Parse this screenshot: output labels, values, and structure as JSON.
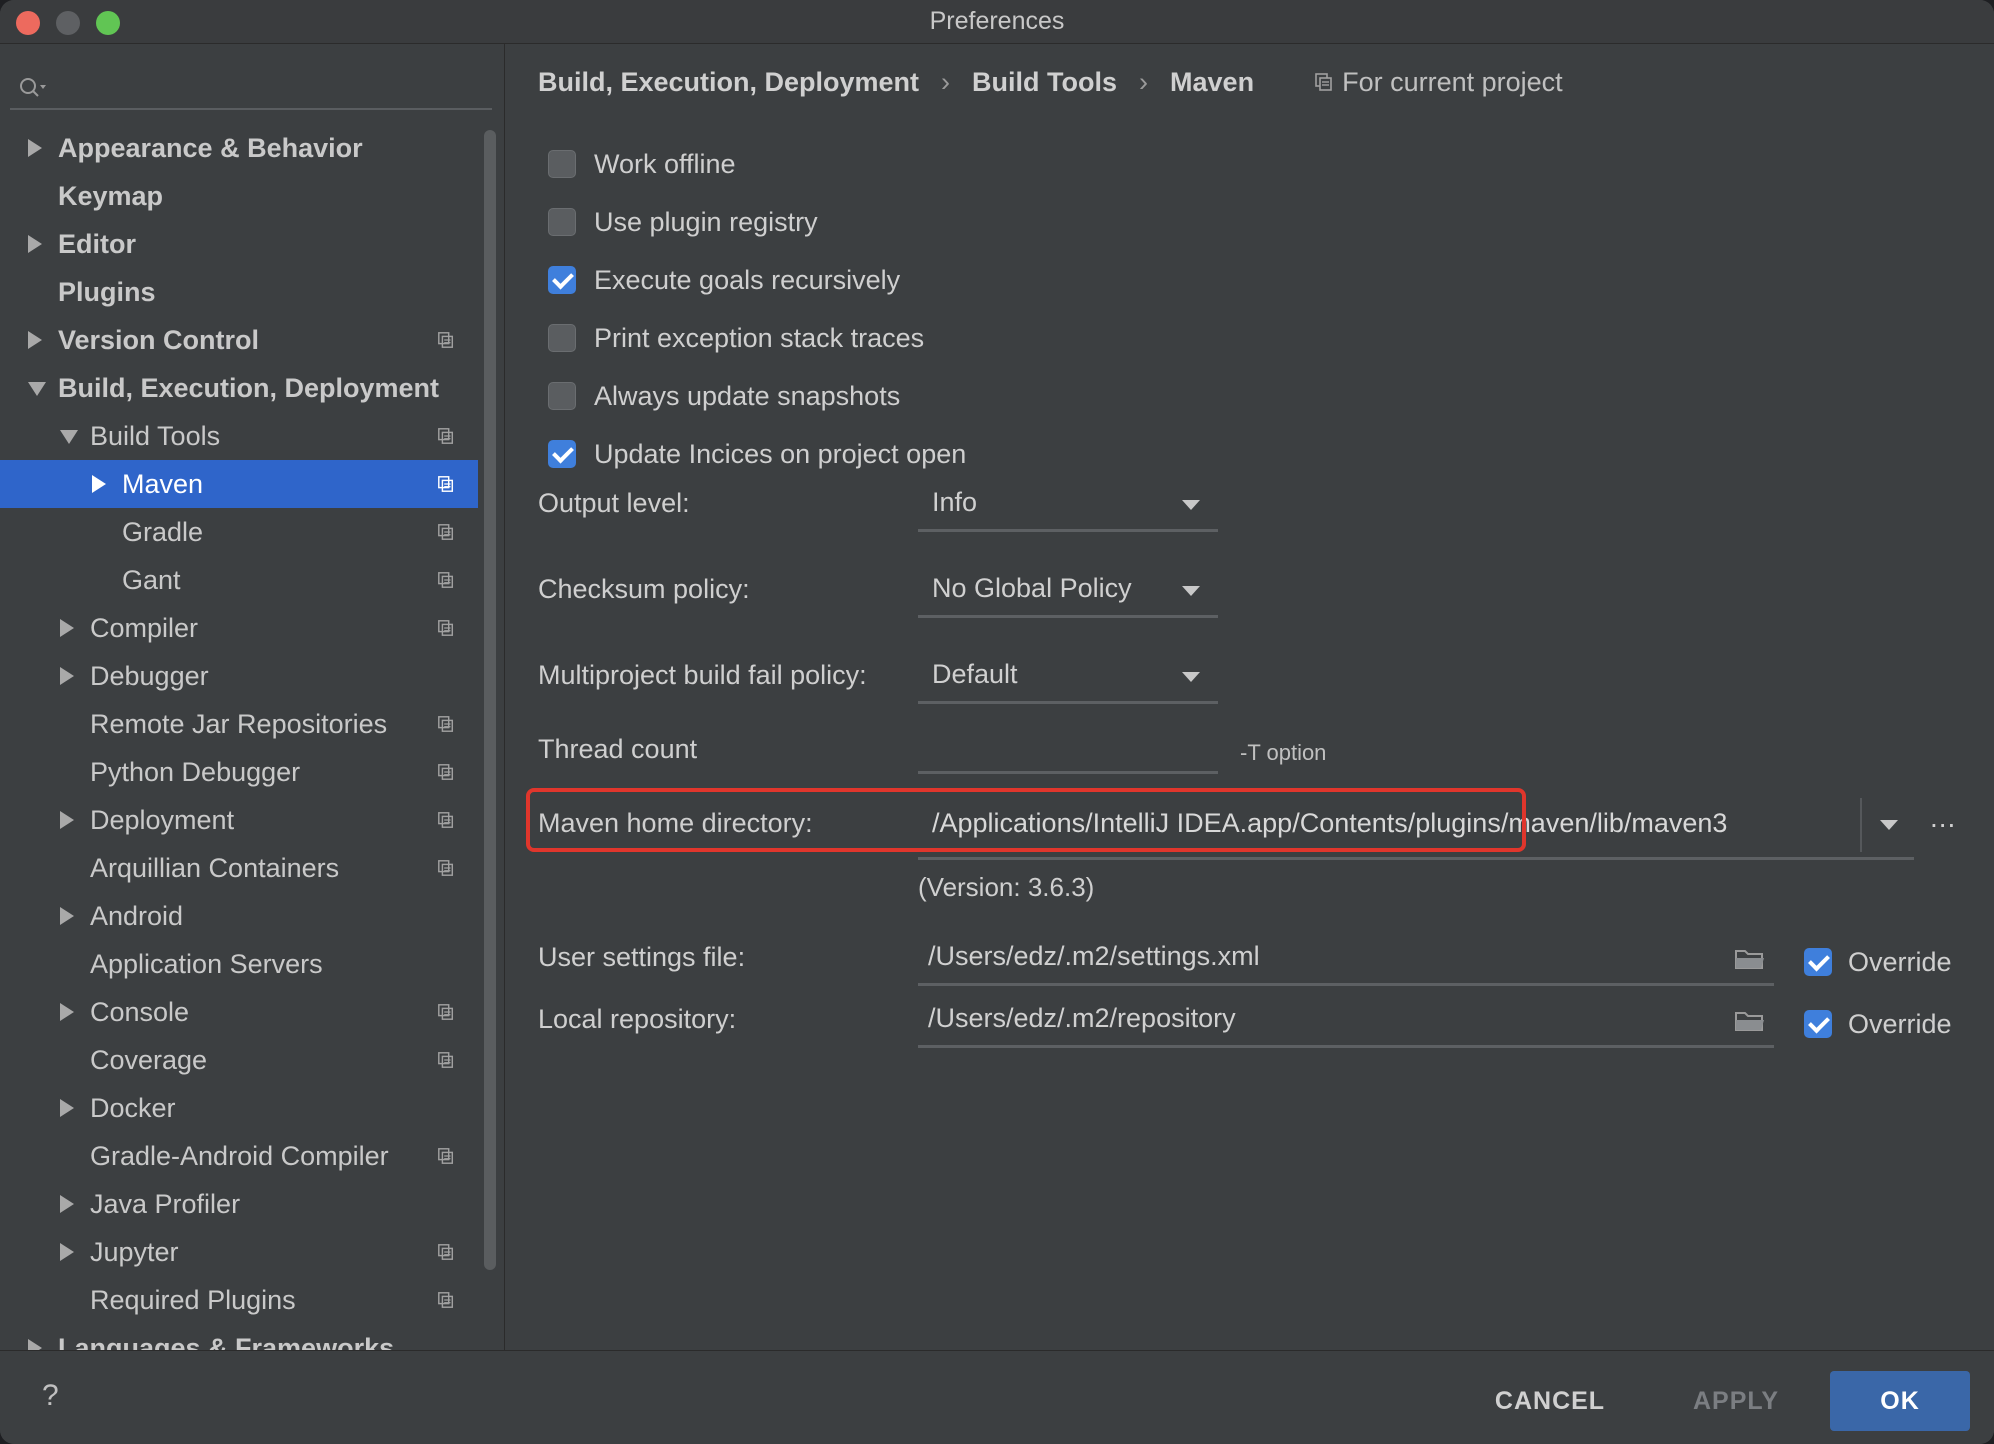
{
  "window": {
    "title": "Preferences"
  },
  "search": {
    "placeholder": ""
  },
  "sidebar": {
    "items": [
      {
        "label": "Appearance & Behavior",
        "indent": 0,
        "arrow": "right",
        "bold": true,
        "proj": false,
        "selected": false
      },
      {
        "label": "Keymap",
        "indent": 0,
        "arrow": "none",
        "bold": true,
        "proj": false,
        "selected": false
      },
      {
        "label": "Editor",
        "indent": 0,
        "arrow": "right",
        "bold": true,
        "proj": false,
        "selected": false
      },
      {
        "label": "Plugins",
        "indent": 0,
        "arrow": "none",
        "bold": true,
        "proj": false,
        "selected": false
      },
      {
        "label": "Version Control",
        "indent": 0,
        "arrow": "right",
        "bold": true,
        "proj": true,
        "selected": false
      },
      {
        "label": "Build, Execution, Deployment",
        "indent": 0,
        "arrow": "down",
        "bold": true,
        "proj": false,
        "selected": false
      },
      {
        "label": "Build Tools",
        "indent": 1,
        "arrow": "down",
        "bold": false,
        "proj": true,
        "selected": false
      },
      {
        "label": "Maven",
        "indent": 2,
        "arrow": "right",
        "bold": false,
        "proj": true,
        "selected": true
      },
      {
        "label": "Gradle",
        "indent": 2,
        "arrow": "none",
        "bold": false,
        "proj": true,
        "selected": false
      },
      {
        "label": "Gant",
        "indent": 2,
        "arrow": "none",
        "bold": false,
        "proj": true,
        "selected": false
      },
      {
        "label": "Compiler",
        "indent": 1,
        "arrow": "right",
        "bold": false,
        "proj": true,
        "selected": false
      },
      {
        "label": "Debugger",
        "indent": 1,
        "arrow": "right",
        "bold": false,
        "proj": false,
        "selected": false
      },
      {
        "label": "Remote Jar Repositories",
        "indent": 1,
        "arrow": "none",
        "bold": false,
        "proj": true,
        "selected": false
      },
      {
        "label": "Python Debugger",
        "indent": 1,
        "arrow": "none",
        "bold": false,
        "proj": true,
        "selected": false
      },
      {
        "label": "Deployment",
        "indent": 1,
        "arrow": "right",
        "bold": false,
        "proj": true,
        "selected": false
      },
      {
        "label": "Arquillian Containers",
        "indent": 1,
        "arrow": "none",
        "bold": false,
        "proj": true,
        "selected": false
      },
      {
        "label": "Android",
        "indent": 1,
        "arrow": "right",
        "bold": false,
        "proj": false,
        "selected": false
      },
      {
        "label": "Application Servers",
        "indent": 1,
        "arrow": "none",
        "bold": false,
        "proj": false,
        "selected": false
      },
      {
        "label": "Console",
        "indent": 1,
        "arrow": "right",
        "bold": false,
        "proj": true,
        "selected": false
      },
      {
        "label": "Coverage",
        "indent": 1,
        "arrow": "none",
        "bold": false,
        "proj": true,
        "selected": false
      },
      {
        "label": "Docker",
        "indent": 1,
        "arrow": "right",
        "bold": false,
        "proj": false,
        "selected": false
      },
      {
        "label": "Gradle-Android Compiler",
        "indent": 1,
        "arrow": "none",
        "bold": false,
        "proj": true,
        "selected": false
      },
      {
        "label": "Java Profiler",
        "indent": 1,
        "arrow": "right",
        "bold": false,
        "proj": false,
        "selected": false
      },
      {
        "label": "Jupyter",
        "indent": 1,
        "arrow": "right",
        "bold": false,
        "proj": true,
        "selected": false
      },
      {
        "label": "Required Plugins",
        "indent": 1,
        "arrow": "none",
        "bold": false,
        "proj": true,
        "selected": false
      },
      {
        "label": "Languages & Frameworks",
        "indent": 0,
        "arrow": "right",
        "bold": true,
        "proj": false,
        "selected": false
      }
    ]
  },
  "breadcrumb": {
    "items": [
      "Build, Execution, Deployment",
      "Build Tools",
      "Maven"
    ],
    "separator": "›",
    "scope": "For current project"
  },
  "checkboxes": [
    {
      "label": "Work offline",
      "checked": false
    },
    {
      "label": "Use plugin registry",
      "checked": false
    },
    {
      "label": "Execute goals recursively",
      "checked": true
    },
    {
      "label": "Print exception stack traces",
      "checked": false
    },
    {
      "label": "Always update snapshots",
      "checked": false
    },
    {
      "label": "Update Incices on project open",
      "checked": true
    }
  ],
  "fields": {
    "output_level": {
      "label": "Output level:",
      "value": "Info"
    },
    "checksum_policy": {
      "label": "Checksum policy:",
      "value": "No Global Policy"
    },
    "multiproject": {
      "label": "Multiproject build fail policy:",
      "value": "Default"
    },
    "thread_count": {
      "label": "Thread count",
      "value": "",
      "hint": "-T option"
    },
    "maven_home": {
      "label": "Maven home directory:",
      "value": "/Applications/IntelliJ IDEA.app/Contents/plugins/maven/lib/maven3",
      "browse": "...",
      "version": "(Version: 3.6.3)"
    },
    "user_settings": {
      "label": "User settings file:",
      "value": "/Users/edz/.m2/settings.xml",
      "override_label": "Override",
      "override": true
    },
    "local_repo": {
      "label": "Local repository:",
      "value": "/Users/edz/.m2/repository",
      "override_label": "Override",
      "override": true
    }
  },
  "buttons": {
    "help": "?",
    "cancel": "CANCEL",
    "apply": "APPLY",
    "ok": "OK"
  },
  "colors": {
    "accent": "#2f65ca",
    "highlight": "#e0362c",
    "ok_button": "#3a67a8"
  }
}
